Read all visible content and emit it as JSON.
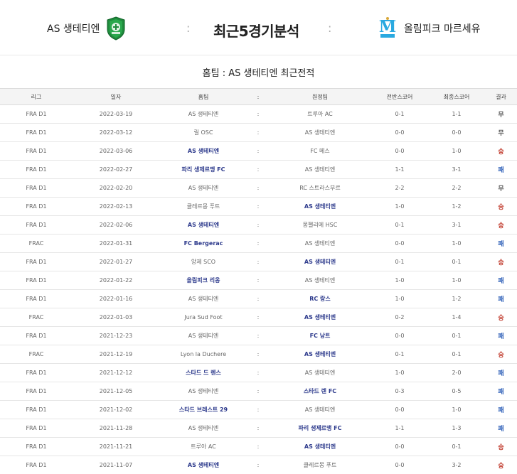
{
  "header": {
    "home_team": "AS 생테티엔",
    "away_team": "올림피크 마르세유",
    "title": "최근5경기분석",
    "colon": ":"
  },
  "section_title": "홈팀 : AS 생테티엔 최근전적",
  "table": {
    "headers": {
      "league": "리그",
      "date": "일자",
      "home": "홈팀",
      "sep": ":",
      "away": "원정팀",
      "half": "전반스코어",
      "final": "최종스코어",
      "result": "결과"
    },
    "rows": [
      {
        "league": "FRA D1",
        "date": "2022-03-19",
        "home": "AS 생테티엔",
        "home_bold": false,
        "sep": ":",
        "away": "트루아 AC",
        "away_bold": false,
        "half": "0-1",
        "final": "1-1",
        "result": "무",
        "result_type": "draw"
      },
      {
        "league": "FRA D1",
        "date": "2022-03-12",
        "home": "릴 OSC",
        "home_bold": false,
        "sep": ":",
        "away": "AS 생테티엔",
        "away_bold": false,
        "half": "0-0",
        "final": "0-0",
        "result": "무",
        "result_type": "draw"
      },
      {
        "league": "FRA D1",
        "date": "2022-03-06",
        "home": "AS 생테티엔",
        "home_bold": true,
        "sep": ":",
        "away": "FC 메스",
        "away_bold": false,
        "half": "0-0",
        "final": "1-0",
        "result": "승",
        "result_type": "win"
      },
      {
        "league": "FRA D1",
        "date": "2022-02-27",
        "home": "파리 생제르맹 FC",
        "home_bold": true,
        "sep": ":",
        "away": "AS 생테티엔",
        "away_bold": false,
        "half": "1-1",
        "final": "3-1",
        "result": "패",
        "result_type": "loss"
      },
      {
        "league": "FRA D1",
        "date": "2022-02-20",
        "home": "AS 생테티엔",
        "home_bold": false,
        "sep": ":",
        "away": "RC 스트라스부르",
        "away_bold": false,
        "half": "2-2",
        "final": "2-2",
        "result": "무",
        "result_type": "draw"
      },
      {
        "league": "FRA D1",
        "date": "2022-02-13",
        "home": "클레르몽 푸트",
        "home_bold": false,
        "sep": ":",
        "away": "AS 생테티엔",
        "away_bold": true,
        "half": "1-0",
        "final": "1-2",
        "result": "승",
        "result_type": "win"
      },
      {
        "league": "FRA D1",
        "date": "2022-02-06",
        "home": "AS 생테티엔",
        "home_bold": true,
        "sep": ":",
        "away": "몽펠리에 HSC",
        "away_bold": false,
        "half": "0-1",
        "final": "3-1",
        "result": "승",
        "result_type": "win"
      },
      {
        "league": "FRAC",
        "date": "2022-01-31",
        "home": "FC Bergerac",
        "home_bold": true,
        "sep": ":",
        "away": "AS 생테티엔",
        "away_bold": false,
        "half": "0-0",
        "final": "1-0",
        "result": "패",
        "result_type": "loss"
      },
      {
        "league": "FRA D1",
        "date": "2022-01-27",
        "home": "앙제 SCO",
        "home_bold": false,
        "sep": ":",
        "away": "AS 생테티엔",
        "away_bold": true,
        "half": "0-1",
        "final": "0-1",
        "result": "승",
        "result_type": "win"
      },
      {
        "league": "FRA D1",
        "date": "2022-01-22",
        "home": "올림피크 리옹",
        "home_bold": true,
        "sep": ":",
        "away": "AS 생테티엔",
        "away_bold": false,
        "half": "1-0",
        "final": "1-0",
        "result": "패",
        "result_type": "loss"
      },
      {
        "league": "FRA D1",
        "date": "2022-01-16",
        "home": "AS 생테티엔",
        "home_bold": false,
        "sep": ":",
        "away": "RC 랑스",
        "away_bold": true,
        "half": "1-0",
        "final": "1-2",
        "result": "패",
        "result_type": "loss"
      },
      {
        "league": "FRAC",
        "date": "2022-01-03",
        "home": "Jura Sud Foot",
        "home_bold": false,
        "sep": ":",
        "away": "AS 생테티엔",
        "away_bold": true,
        "half": "0-2",
        "final": "1-4",
        "result": "승",
        "result_type": "win"
      },
      {
        "league": "FRA D1",
        "date": "2021-12-23",
        "home": "AS 생테티엔",
        "home_bold": false,
        "sep": ":",
        "away": "FC 낭트",
        "away_bold": true,
        "half": "0-0",
        "final": "0-1",
        "result": "패",
        "result_type": "loss"
      },
      {
        "league": "FRAC",
        "date": "2021-12-19",
        "home": "Lyon la Duchere",
        "home_bold": false,
        "sep": ":",
        "away": "AS 생테티엔",
        "away_bold": true,
        "half": "0-1",
        "final": "0-1",
        "result": "승",
        "result_type": "win"
      },
      {
        "league": "FRA D1",
        "date": "2021-12-12",
        "home": "스타드 드 렌스",
        "home_bold": true,
        "sep": ":",
        "away": "AS 생테티엔",
        "away_bold": false,
        "half": "1-0",
        "final": "2-0",
        "result": "패",
        "result_type": "loss"
      },
      {
        "league": "FRA D1",
        "date": "2021-12-05",
        "home": "AS 생테티엔",
        "home_bold": false,
        "sep": ":",
        "away": "스타드 렌 FC",
        "away_bold": true,
        "half": "0-3",
        "final": "0-5",
        "result": "패",
        "result_type": "loss"
      },
      {
        "league": "FRA D1",
        "date": "2021-12-02",
        "home": "스타드 브레스트 29",
        "home_bold": true,
        "sep": ":",
        "away": "AS 생테티엔",
        "away_bold": false,
        "half": "0-0",
        "final": "1-0",
        "result": "패",
        "result_type": "loss"
      },
      {
        "league": "FRA D1",
        "date": "2021-11-28",
        "home": "AS 생테티엔",
        "home_bold": false,
        "sep": ":",
        "away": "파리 생제르맹 FC",
        "away_bold": true,
        "half": "1-1",
        "final": "1-3",
        "result": "패",
        "result_type": "loss"
      },
      {
        "league": "FRA D1",
        "date": "2021-11-21",
        "home": "트루아 AC",
        "home_bold": false,
        "sep": ":",
        "away": "AS 생테티엔",
        "away_bold": true,
        "half": "0-0",
        "final": "0-1",
        "result": "승",
        "result_type": "win"
      },
      {
        "league": "FRA D1",
        "date": "2021-11-07",
        "home": "AS 생테티엔",
        "home_bold": true,
        "sep": ":",
        "away": "클레르몽 푸트",
        "away_bold": false,
        "half": "0-0",
        "final": "3-2",
        "result": "승",
        "result_type": "win"
      }
    ]
  },
  "colors": {
    "win": "#c0392b",
    "loss": "#2d5fb8",
    "draw": "#555555",
    "bold_team": "#2d3a8c",
    "home_logo": "#1f8a3c",
    "away_logo": "#2aa9e0"
  },
  "icons": {
    "home_logo": "saint-etienne-crest-icon",
    "away_logo": "marseille-crest-icon"
  }
}
